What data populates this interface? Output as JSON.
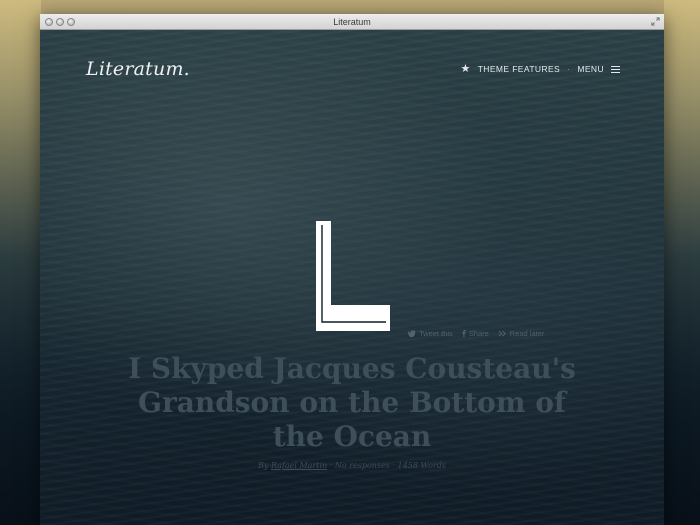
{
  "window": {
    "title": "Literatum"
  },
  "site": {
    "logo": "Literatum.",
    "nav": {
      "theme_features": "THEME FEATURES",
      "separator": "·",
      "menu": "MENU"
    }
  },
  "hero": {
    "letter": "L"
  },
  "share": {
    "tweet": "Tweet this",
    "facebook": "Share",
    "read_later": "Read later"
  },
  "article": {
    "title": "I Skyped Jacques Cousteau's Grandson on the Bottom of the Ocean",
    "byline_prefix": "By",
    "author": "Rafael Martin",
    "separator": "·",
    "responses": "No responses",
    "word_count": "1458 Words"
  },
  "icons": [
    "star-icon",
    "hamburger-icon",
    "twitter-icon",
    "facebook-icon",
    "read-later-icon"
  ]
}
